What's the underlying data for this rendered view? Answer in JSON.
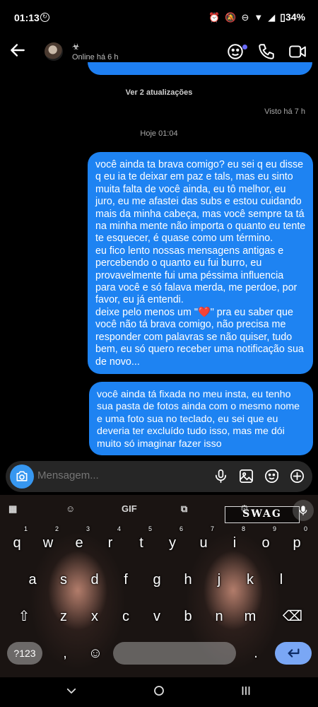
{
  "status_bar": {
    "time": "01:13",
    "battery": "34%"
  },
  "header": {
    "contact_name": "☣",
    "contact_status": "Online há 6 h",
    "icons": [
      "back-arrow-icon",
      "video-chat-effects-icon",
      "phone-icon",
      "video-camera-icon"
    ]
  },
  "thread": {
    "updates_link": "Ver 2 atualizações",
    "seen_label": "Visto há 7 h",
    "date_divider": "Hoje 01:04",
    "messages": [
      {
        "text": "você ainda ta brava comigo? eu sei q eu disse q eu ia te deixar em paz e tals, mas eu sinto muita falta de você ainda, eu tô melhor, eu juro, eu me afastei das subs e estou cuidando mais da minha cabeça, mas você sempre ta tá na minha mente não importa o quanto eu tente te esquecer, é quase como um término.\neu fico lento nossas mensagens antigas e percebendo o quanto eu fui burro, eu provavelmente fui uma péssima influencia para você e só falava merda, me perdoe, por favor, eu já entendi.\ndeixe pelo menos um \"❤️\" pra eu saber que você não tá brava comigo, não precisa me responder com palavras se não quiser, tudo bem, eu só quero receber uma notificação sua de novo..."
      },
      {
        "text": "você ainda tá fixada no meu insta, eu tenho sua pasta de fotos ainda com o mesmo nome e uma foto sua no teclado, eu sei que eu deveria ter excluído tudo isso, mas me dói muito só imaginar fazer isso"
      }
    ]
  },
  "composer": {
    "placeholder": "Mensagem...",
    "icons": [
      "camera-icon",
      "microphone-icon",
      "gallery-icon",
      "sticker-icon",
      "plus-icon"
    ]
  },
  "keyboard": {
    "toolbar": {
      "gif_label": "GIF",
      "theme_logo_text": "SWAG"
    },
    "rows": [
      [
        {
          "k": "q",
          "h": "1"
        },
        {
          "k": "w",
          "h": "2"
        },
        {
          "k": "e",
          "h": "3"
        },
        {
          "k": "r",
          "h": "4"
        },
        {
          "k": "t",
          "h": "5"
        },
        {
          "k": "y",
          "h": "6"
        },
        {
          "k": "u",
          "h": "7"
        },
        {
          "k": "i",
          "h": "8"
        },
        {
          "k": "o",
          "h": "9"
        },
        {
          "k": "p",
          "h": "0"
        }
      ],
      [
        {
          "k": "a"
        },
        {
          "k": "s"
        },
        {
          "k": "d"
        },
        {
          "k": "f"
        },
        {
          "k": "g"
        },
        {
          "k": "h"
        },
        {
          "k": "j"
        },
        {
          "k": "k"
        },
        {
          "k": "l"
        }
      ],
      [
        {
          "k": "z"
        },
        {
          "k": "x"
        },
        {
          "k": "c"
        },
        {
          "k": "v"
        },
        {
          "k": "b"
        },
        {
          "k": "n"
        },
        {
          "k": "m"
        }
      ]
    ],
    "symbols_label": "?123",
    "comma_label": ","
  },
  "colors": {
    "bubble": "#1e83f2",
    "camera_button": "#3797f0",
    "enter_key": "#7aa7f5"
  }
}
